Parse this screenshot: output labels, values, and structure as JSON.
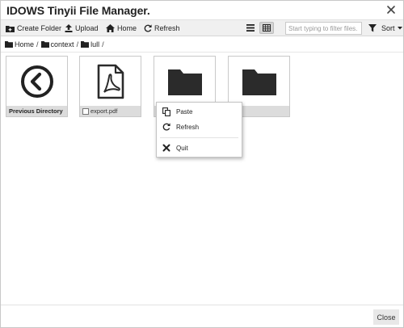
{
  "window": {
    "title": "IDOWS Tinyii File Manager."
  },
  "toolbar": {
    "create_folder": "Create Folder",
    "upload": "Upload",
    "home": "Home",
    "refresh": "Refresh",
    "filter_placeholder": "Start typing to filter files.",
    "filter_value": "",
    "sort": "Sort",
    "active_view": "grid"
  },
  "breadcrumb": [
    {
      "label": "Home"
    },
    {
      "label": "context"
    },
    {
      "label": "lull"
    }
  ],
  "files": [
    {
      "label": "Previous Directory",
      "kind": "parent"
    },
    {
      "label": "export.pdf",
      "kind": "pdf"
    },
    {
      "label": "",
      "kind": "folder"
    },
    {
      "label": "",
      "kind": "folder"
    }
  ],
  "context_menu": {
    "items": [
      {
        "label": "Paste",
        "icon": "paste-icon"
      },
      {
        "label": "Refresh",
        "icon": "refresh-icon"
      },
      {
        "label": "Quit",
        "icon": "close-icon"
      }
    ]
  },
  "footer": {
    "close_label": "Close"
  },
  "colors": {
    "folder": "#2b2b2b",
    "label_bg": "#dcdcdc",
    "toolbar_bg": "#f0f0f0"
  }
}
